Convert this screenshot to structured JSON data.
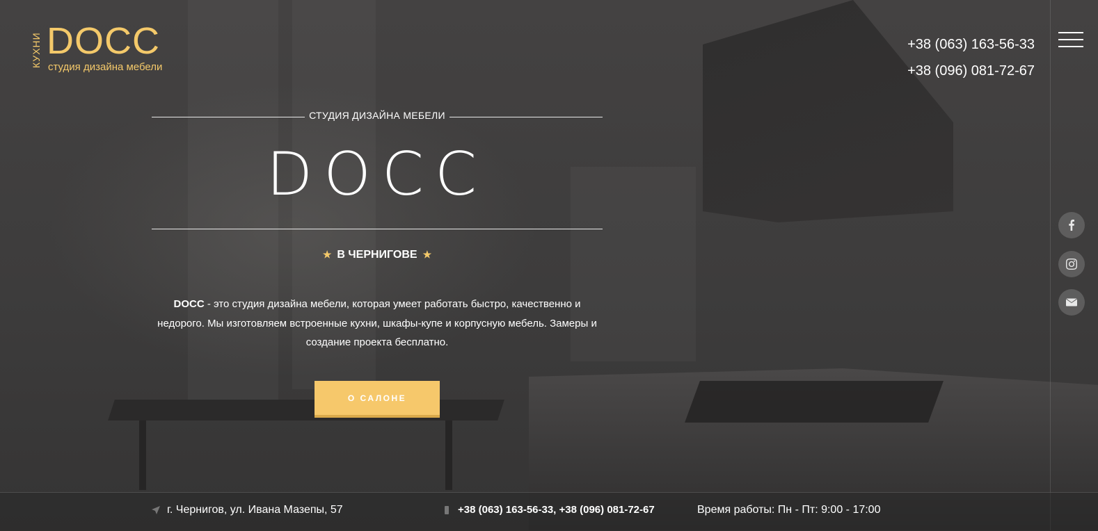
{
  "logo": {
    "vertical_text": "КУХНИ",
    "brand": "DOCC",
    "tagline": "студия дизайна мебели"
  },
  "header": {
    "phones": [
      "+38 (063) 163-56-33",
      "+38 (096) 081-72-67"
    ]
  },
  "icons": {
    "menu": "hamburger-icon",
    "facebook": "facebook-icon",
    "instagram": "instagram-icon",
    "mail": "mail-icon"
  },
  "hero": {
    "subtitle": "СТУДИЯ ДИЗАЙНА МЕБЕЛИ",
    "title": "DOCC",
    "city": "В ЧЕРНИГОВЕ",
    "description_lead": "DOCC",
    "description_rest": " - это студия дизайна мебели, которая умеет работать быстро, качественно и недорого. Мы изготовляем встроенные кухни, шкафы-купе и корпусную мебель. Замеры и создание проекта бесплатно.",
    "button_label": "О САЛОНЕ"
  },
  "footer": {
    "address": "г. Чернигов, ул. Ивана Мазепы, 57",
    "phones": "+38 (063) 163-56-33, +38 (096) 081-72-67",
    "hours": "Время работы: Пн - Пт: 9:00 - 17:00"
  },
  "colors": {
    "accent": "#f6c86b",
    "accent_dark": "#d9a94b",
    "logo": "#f4c96a"
  }
}
